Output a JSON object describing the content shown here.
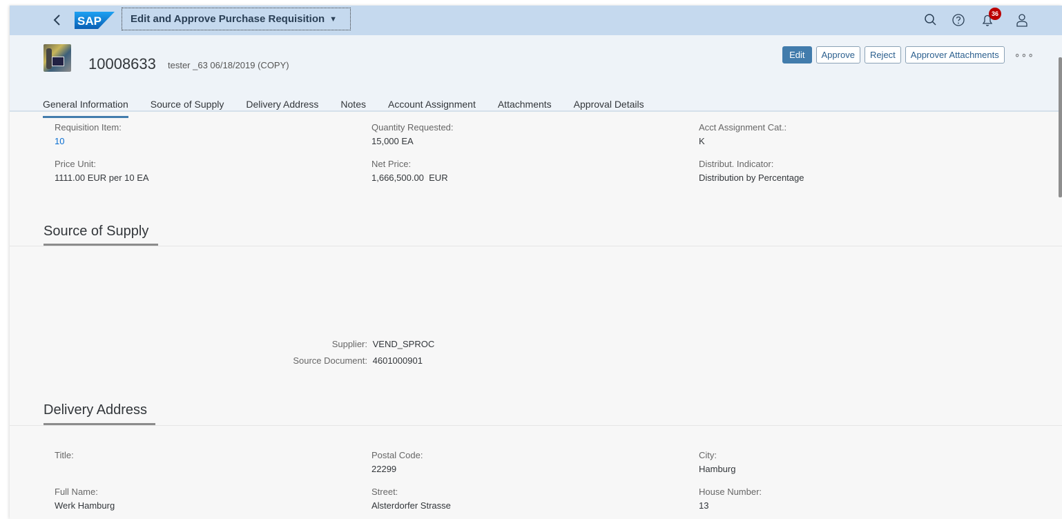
{
  "shell": {
    "back_icon": "chevron-left-icon",
    "logo_text": "SAP",
    "app_title": "Edit and Approve Purchase Requisition",
    "notification_count": "36",
    "accent": "#c5d9ee"
  },
  "header": {
    "id": "10008633",
    "subtitle": "tester _63 06/18/2019 (COPY)",
    "actions": {
      "edit": "Edit",
      "approve": "Approve",
      "reject": "Reject",
      "attachments": "Approver Attachments"
    },
    "tabs": [
      "General Information",
      "Source of Supply",
      "Delivery Address",
      "Notes",
      "Account Assignment",
      "Attachments",
      "Approval Details"
    ]
  },
  "general": {
    "requisition_item": {
      "label": "Requisition Item:",
      "value": "10"
    },
    "quantity_requested": {
      "label": "Quantity Requested:",
      "value": "15,000 EA"
    },
    "acct_assignment_cat": {
      "label": "Acct Assignment Cat.:",
      "value": "K"
    },
    "price_unit": {
      "label": "Price Unit:",
      "value": "1111.00 EUR per 10 EA"
    },
    "net_price": {
      "label": "Net Price:",
      "value": "1,666,500.00  EUR"
    },
    "distribut_indicator": {
      "label": "Distribut. Indicator:",
      "value": "Distribution by Percentage"
    }
  },
  "source_of_supply": {
    "title": "Source of Supply",
    "supplier": {
      "label": "Supplier:",
      "value": "VEND_SPROC"
    },
    "source_document": {
      "label": "Source Document:",
      "value": "4601000901"
    }
  },
  "delivery_address": {
    "title": "Delivery Address",
    "title_field": {
      "label": "Title:",
      "value": ""
    },
    "postal_code": {
      "label": "Postal Code:",
      "value": "22299"
    },
    "city": {
      "label": "City:",
      "value": "Hamburg"
    },
    "full_name": {
      "label": "Full Name:",
      "value": "Werk Hamburg"
    },
    "street": {
      "label": "Street:",
      "value": "Alsterdorfer Strasse"
    },
    "house_number": {
      "label": "House Number:",
      "value": "13"
    }
  }
}
